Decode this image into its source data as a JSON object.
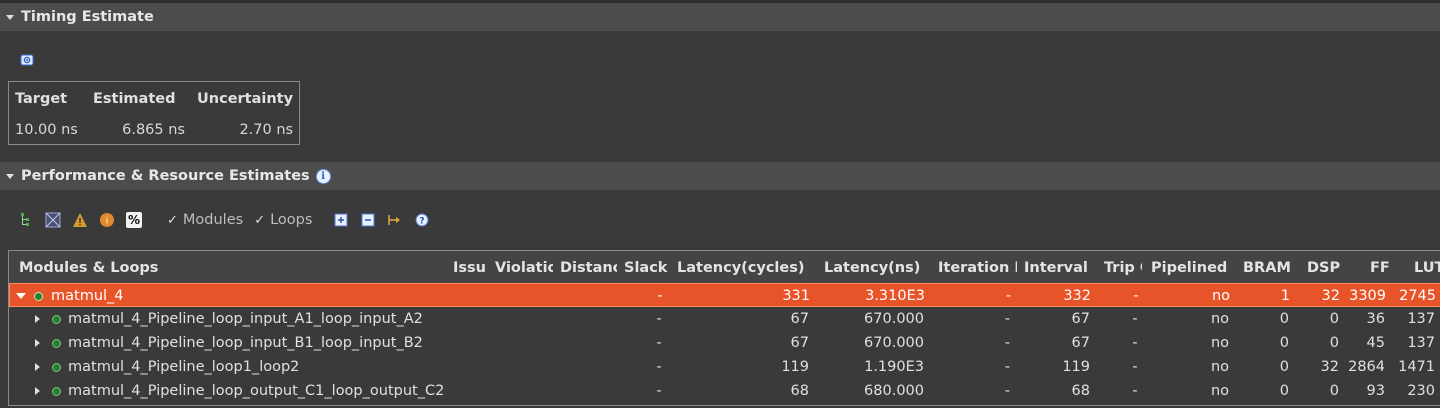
{
  "timing": {
    "header": "Timing Estimate",
    "table": {
      "headers": [
        "Target",
        "Estimated",
        "Uncertainty"
      ],
      "values": [
        "10.00 ns",
        "6.865 ns",
        "2.70 ns"
      ]
    }
  },
  "perf": {
    "header": "Performance & Resource Estimates",
    "toolbar": {
      "modules_label": "Modules",
      "loops_label": "Loops",
      "percent_label": "%"
    },
    "columns": [
      "Modules & Loops",
      "Issu",
      "Violatio",
      "Distanc",
      "Slack",
      "Latency(cycles)",
      "Latency(ns)",
      "Iteration L",
      "Interval",
      "Trip C",
      "Pipelined",
      "BRAM",
      "DSP",
      "FF",
      "LUT"
    ],
    "rows": [
      {
        "name": "matmul_4",
        "slack": "-",
        "lat_cycles": "331",
        "lat_ns": "3.310E3",
        "iteration": "-",
        "interval": "332",
        "trip": "-",
        "pipelined": "no",
        "bram": "1",
        "dsp": "32",
        "ff": "3309",
        "lut": "2745"
      },
      {
        "name": "matmul_4_Pipeline_loop_input_A1_loop_input_A2",
        "slack": "-",
        "lat_cycles": "67",
        "lat_ns": "670.000",
        "iteration": "-",
        "interval": "67",
        "trip": "-",
        "pipelined": "no",
        "bram": "0",
        "dsp": "0",
        "ff": "36",
        "lut": "137"
      },
      {
        "name": "matmul_4_Pipeline_loop_input_B1_loop_input_B2",
        "slack": "-",
        "lat_cycles": "67",
        "lat_ns": "670.000",
        "iteration": "-",
        "interval": "67",
        "trip": "-",
        "pipelined": "no",
        "bram": "0",
        "dsp": "0",
        "ff": "45",
        "lut": "137"
      },
      {
        "name": "matmul_4_Pipeline_loop1_loop2",
        "slack": "-",
        "lat_cycles": "119",
        "lat_ns": "1.190E3",
        "iteration": "-",
        "interval": "119",
        "trip": "-",
        "pipelined": "no",
        "bram": "0",
        "dsp": "32",
        "ff": "2864",
        "lut": "1471"
      },
      {
        "name": "matmul_4_Pipeline_loop_output_C1_loop_output_C2",
        "slack": "-",
        "lat_cycles": "68",
        "lat_ns": "680.000",
        "iteration": "-",
        "interval": "68",
        "trip": "-",
        "pipelined": "no",
        "bram": "0",
        "dsp": "0",
        "ff": "93",
        "lut": "230"
      }
    ]
  },
  "colors": {
    "selection": "#e8542a",
    "background": "#3a3a3a",
    "header": "#4c4c4c"
  }
}
